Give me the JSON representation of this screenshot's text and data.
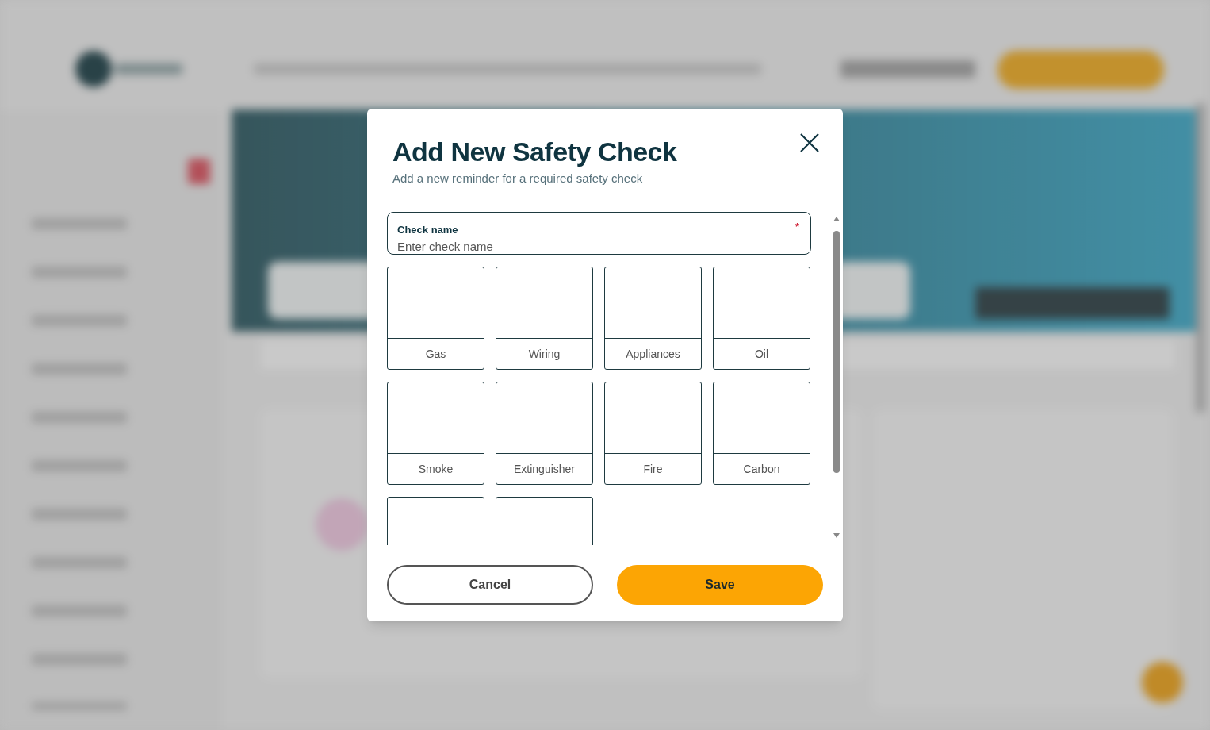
{
  "dialog": {
    "title": "Add New Safety Check",
    "subtitle": "Add a new reminder for a required safety check",
    "field": {
      "label": "Check name",
      "required_mark": "*",
      "placeholder": "Enter check name"
    },
    "tiles": [
      {
        "kind": "tile",
        "label": "Gas"
      },
      {
        "kind": "tile",
        "label": "Wiring"
      },
      {
        "kind": "tile",
        "label": "Appliances"
      },
      {
        "kind": "tile",
        "label": "Oil"
      },
      {
        "kind": "tile",
        "label": "Smoke"
      },
      {
        "kind": "tile",
        "label": "Extinguisher"
      },
      {
        "kind": "tile",
        "label": "Fire"
      },
      {
        "kind": "tile",
        "label": "Carbon"
      },
      {
        "kind": "cut"
      },
      {
        "kind": "cut"
      }
    ],
    "buttons": [
      {
        "kind": "cancel",
        "label": "Cancel"
      },
      {
        "kind": "save",
        "label": "Save"
      }
    ]
  }
}
